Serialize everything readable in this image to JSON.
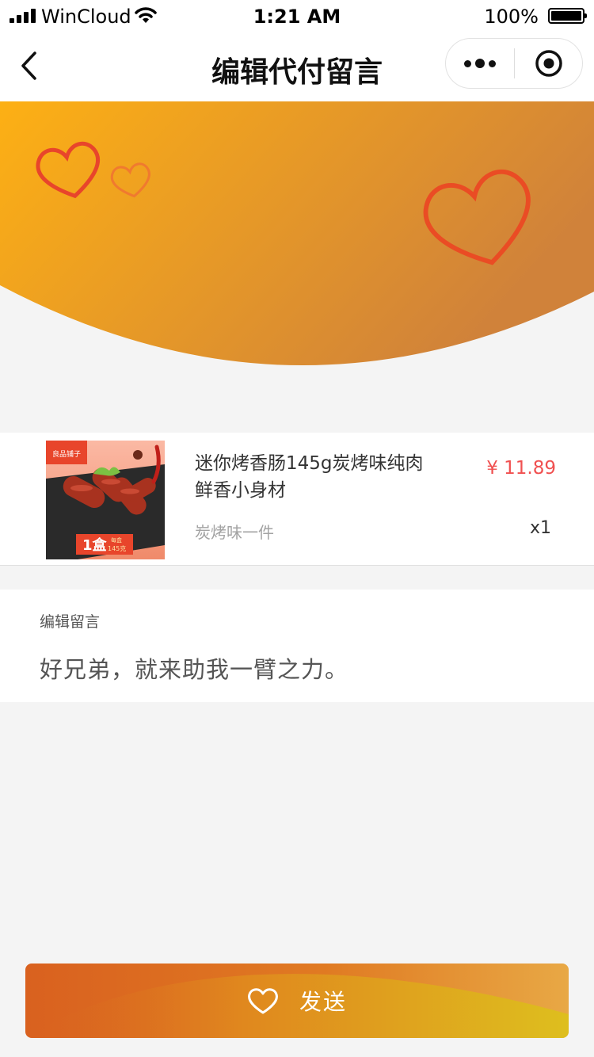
{
  "status_bar": {
    "carrier": "WinCloud",
    "time": "1:21 AM",
    "battery": "100%"
  },
  "nav": {
    "title": "编辑代付留言"
  },
  "product": {
    "name": "迷你烤香肠145g炭烤味纯肉鲜香小身材",
    "spec": "炭烤味一件",
    "price": "¥ 11.89",
    "quantity": "x1",
    "image": {
      "brand_label": "良品铺子",
      "count_label": "1盒",
      "per_box_label": "每盒",
      "weight_label": "145克"
    }
  },
  "message": {
    "label": "编辑留言",
    "text": "好兄弟，就来助我一臂之力。"
  },
  "send_button": {
    "label": "发送"
  },
  "colors": {
    "banner_start": "#fdb014",
    "banner_end": "#d0823a",
    "price": "#f05050",
    "button_start": "#d9611f",
    "button_end": "#ddc11a"
  }
}
